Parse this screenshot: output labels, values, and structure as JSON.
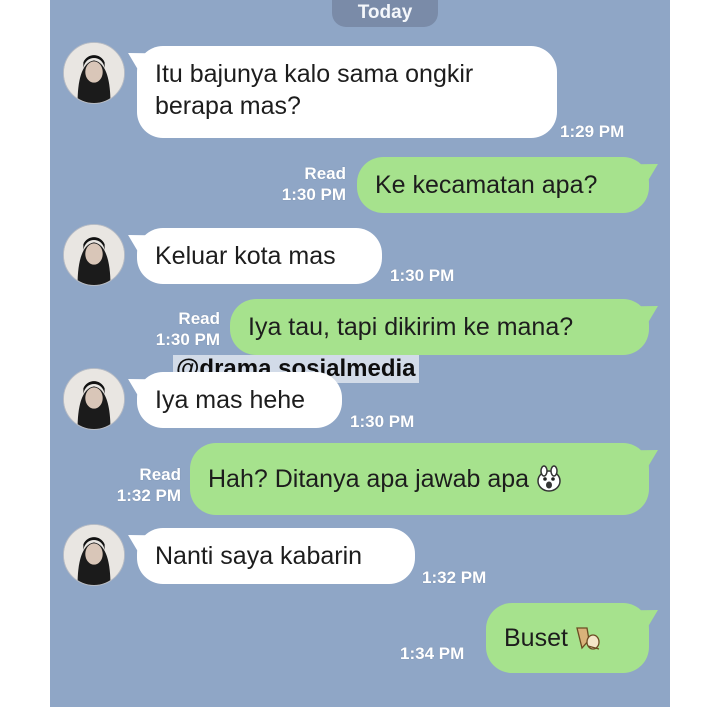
{
  "chat": {
    "date_label": "Today",
    "watermark": "@drama.sosialmedia",
    "colors": {
      "background": "#8fa6c6",
      "incoming": "#ffffff",
      "outgoing": "#a6e28d"
    },
    "messages": [
      {
        "side": "in",
        "text_line1": "Itu bajunya kalo sama ongkir",
        "text_line2": "berapa mas?",
        "time": "1:29 PM"
      },
      {
        "side": "out",
        "text": "Ke kecamatan apa?",
        "read": "Read",
        "time": "1:30 PM"
      },
      {
        "side": "in",
        "text": "Keluar kota mas",
        "time": "1:30 PM"
      },
      {
        "side": "out",
        "text": "Iya tau, tapi dikirim ke mana?",
        "read": "Read",
        "time": "1:30 PM"
      },
      {
        "side": "in",
        "text": "Iya mas hehe",
        "time": "1:30 PM"
      },
      {
        "side": "out",
        "text": "Hah? Ditanya apa jawab apa",
        "read": "Read",
        "time": "1:32 PM",
        "sticker": "shocked-face-sticker-icon"
      },
      {
        "side": "in",
        "text": "Nanti saya kabarin",
        "time": "1:32 PM"
      },
      {
        "side": "out",
        "text": "Buset",
        "time": "1:34 PM",
        "sticker": "fleeing-sticker-icon"
      }
    ]
  }
}
